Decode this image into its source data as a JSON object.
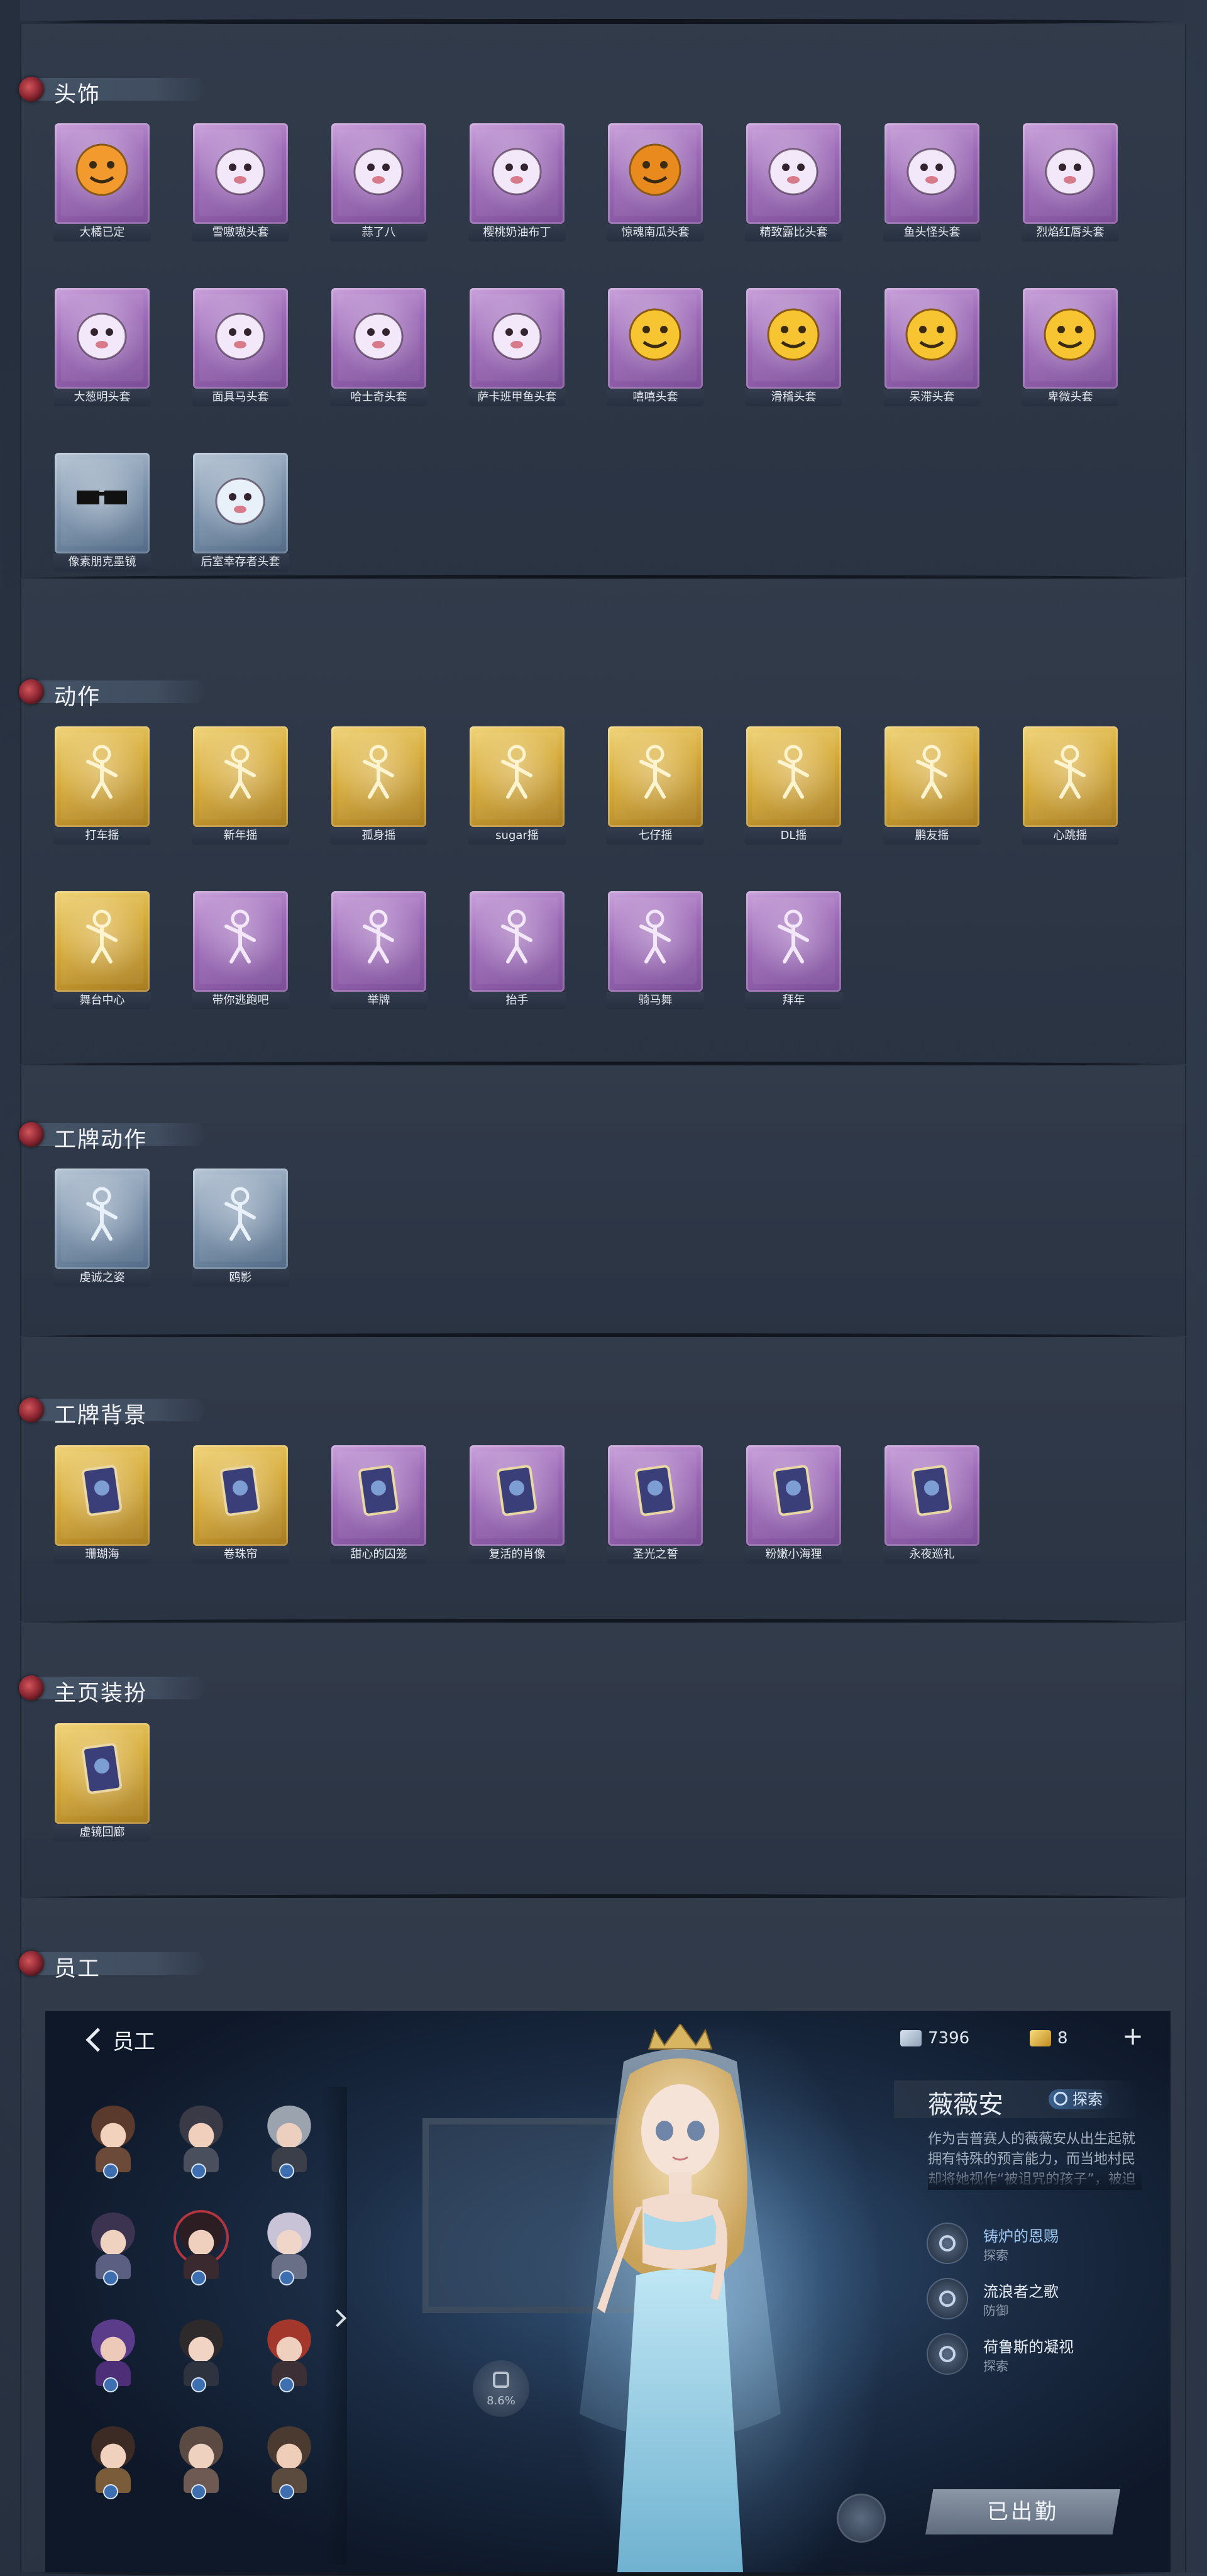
{
  "sections": {
    "headwear": {
      "title": "头饰",
      "items": [
        {
          "label": "大橘已定",
          "icon": "orange-head-icon",
          "rarity": "purple"
        },
        {
          "label": "雪嗷嗷头套",
          "icon": "snow-pig-head-icon",
          "rarity": "purple"
        },
        {
          "label": "蒜了八",
          "icon": "garlic-head-icon",
          "rarity": "purple"
        },
        {
          "label": "樱桃奶油布丁",
          "icon": "pudding-head-icon",
          "rarity": "purple"
        },
        {
          "label": "惊魂南瓜头套",
          "icon": "pumpkin-head-icon",
          "rarity": "purple"
        },
        {
          "label": "精致露比头套",
          "icon": "pink-face-head-icon",
          "rarity": "purple"
        },
        {
          "label": "鱼头怪头套",
          "icon": "fish-head-icon",
          "rarity": "purple"
        },
        {
          "label": "烈焰红唇头套",
          "icon": "yellow-mascot-head-icon",
          "rarity": "purple"
        },
        {
          "label": "大葱明头套",
          "icon": "green-onion-head-icon",
          "rarity": "purple"
        },
        {
          "label": "面具马头套",
          "icon": "horse-head-icon",
          "rarity": "purple"
        },
        {
          "label": "哈士奇头套",
          "icon": "husky-head-icon",
          "rarity": "purple"
        },
        {
          "label": "萨卡班甲鱼头套",
          "icon": "armored-fish-head-icon",
          "rarity": "purple"
        },
        {
          "label": "嘻嘻头套",
          "icon": "grin-emoji-head-icon",
          "rarity": "purple"
        },
        {
          "label": "滑稽头套",
          "icon": "smirk-emoji-head-icon",
          "rarity": "purple"
        },
        {
          "label": "呆滞头套",
          "icon": "dazed-emoji-head-icon",
          "rarity": "purple"
        },
        {
          "label": "卑微头套",
          "icon": "humble-emoji-head-icon",
          "rarity": "purple"
        },
        {
          "label": "像素朋克墨镜",
          "icon": "pixel-sunglasses-icon",
          "rarity": "blue"
        },
        {
          "label": "后室幸存者头套",
          "icon": "gas-mask-helmet-icon",
          "rarity": "blue"
        }
      ]
    },
    "actions": {
      "title": "动作",
      "items": [
        {
          "label": "打车摇",
          "icon": "dance-pose-icon",
          "rarity": "gold"
        },
        {
          "label": "新年摇",
          "icon": "dance-pose-icon",
          "rarity": "gold"
        },
        {
          "label": "孤身摇",
          "icon": "dance-pose-icon",
          "rarity": "gold"
        },
        {
          "label": "sugar摇",
          "icon": "dance-pose-icon",
          "rarity": "gold"
        },
        {
          "label": "七仔摇",
          "icon": "dance-pose-icon",
          "rarity": "gold"
        },
        {
          "label": "DL摇",
          "icon": "dance-pose-icon",
          "rarity": "gold"
        },
        {
          "label": "鹏友摇",
          "icon": "dance-pose-icon",
          "rarity": "gold"
        },
        {
          "label": "心跳摇",
          "icon": "dance-pose-icon",
          "rarity": "gold"
        },
        {
          "label": "舞台中心",
          "icon": "dance-pose-icon",
          "rarity": "gold"
        },
        {
          "label": "带你逃跑吧",
          "icon": "dance-pose-icon",
          "rarity": "purple"
        },
        {
          "label": "举牌",
          "icon": "sign-pose-icon",
          "rarity": "purple"
        },
        {
          "label": "抬手",
          "icon": "raise-hand-pose-icon",
          "rarity": "purple"
        },
        {
          "label": "骑马舞",
          "icon": "dance-pose-icon",
          "rarity": "purple"
        },
        {
          "label": "拜年",
          "icon": "bow-pose-icon",
          "rarity": "purple"
        }
      ]
    },
    "badge_actions": {
      "title": "工牌动作",
      "items": [
        {
          "label": "虔诚之姿",
          "icon": "silhouette-pose-icon",
          "rarity": "blue"
        },
        {
          "label": "鸥影",
          "icon": "silhouette-pose-icon",
          "rarity": "blue"
        }
      ]
    },
    "badge_backgrounds": {
      "title": "工牌背景",
      "items": [
        {
          "label": "珊瑚海",
          "icon": "card-frame-icon",
          "rarity": "gold"
        },
        {
          "label": "卷珠帘",
          "icon": "card-frame-icon",
          "rarity": "gold"
        },
        {
          "label": "甜心的囚笼",
          "icon": "card-frame-icon",
          "rarity": "purple"
        },
        {
          "label": "复活的肖像",
          "icon": "card-frame-icon",
          "rarity": "purple"
        },
        {
          "label": "圣光之誓",
          "icon": "card-frame-icon",
          "rarity": "purple"
        },
        {
          "label": "粉嫩小海狸",
          "icon": "card-frame-icon",
          "rarity": "purple"
        },
        {
          "label": "永夜巡礼",
          "icon": "card-frame-icon",
          "rarity": "purple"
        }
      ]
    },
    "home_decor": {
      "title": "主页装扮",
      "items": [
        {
          "label": "虚镜回廊",
          "icon": "gallery-frame-icon",
          "rarity": "gold"
        }
      ]
    },
    "staff": {
      "title": "员工"
    }
  },
  "staff_screen": {
    "back_label": "员工",
    "currency_1": "7396",
    "currency_2": "8",
    "add_label": "+",
    "character_name": "薇薇安",
    "character_tag": "探索",
    "bio": "作为吉普赛人的薇薇安从出生起就拥有特殊的预言能力，而当地村民却将她视作“被诅咒的孩子”，被迫远离家乡的薇薇安……",
    "skills": [
      {
        "name": "铸炉的恩赐",
        "type": "探索",
        "highlight": true
      },
      {
        "name": "流浪者之歌",
        "type": "防御",
        "highlight": false
      },
      {
        "name": "荷鲁斯的凝视",
        "type": "探索",
        "highlight": false
      }
    ],
    "deploy_label": "已出勤",
    "loyalty_percent": "8.6%"
  },
  "colors": {
    "page_bg": "#262f3e",
    "panel_bg": "#2c3646",
    "accent_red": "#b4343e"
  }
}
